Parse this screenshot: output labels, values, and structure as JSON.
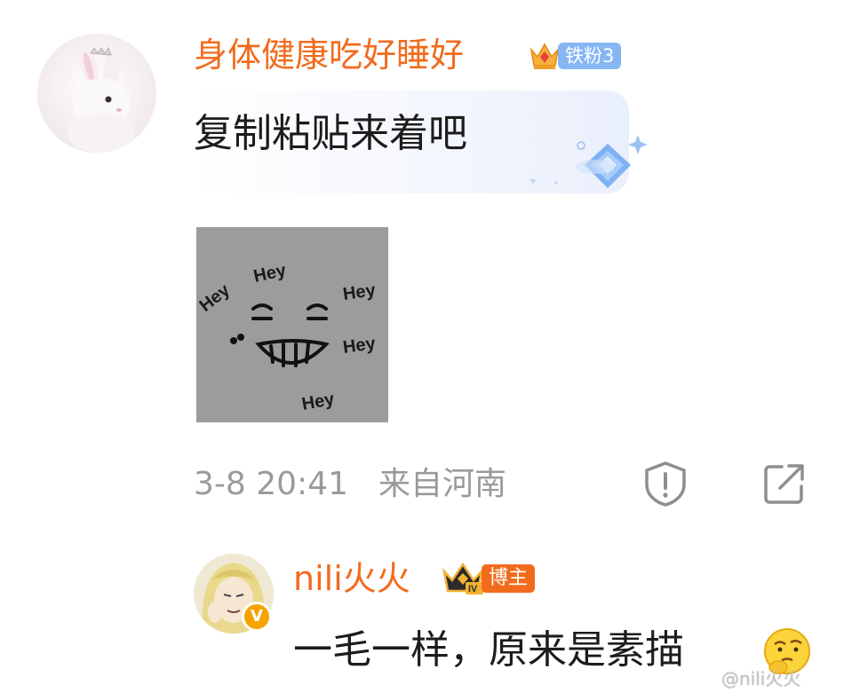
{
  "comment": {
    "username": "身体健康吃好睡好",
    "fan_badge": {
      "label": "铁粉3",
      "icon": "crown-icon"
    },
    "text": "复制粘贴来着吧",
    "image_texts": [
      "Hey",
      "Hey",
      "Hey",
      "Hey",
      "Hey"
    ],
    "time": "3-8 20:41",
    "location": "来自河南",
    "actions": {
      "report_icon": "report-icon",
      "share_icon": "share-icon"
    }
  },
  "reply": {
    "username": "nili火火",
    "badge": {
      "label": "博主",
      "icon": "crown-icon",
      "level": "IV"
    },
    "verified": "V",
    "text": "一毛一样，原来是素描",
    "emoji": "thinking-emoji"
  },
  "watermark": "@nili火火",
  "colors": {
    "username": "#f26b1d",
    "text": "#1c1c1c",
    "meta": "#9a9a9a",
    "fan_badge": "#86b7f3",
    "blogger_badge": "#f26b1d"
  }
}
